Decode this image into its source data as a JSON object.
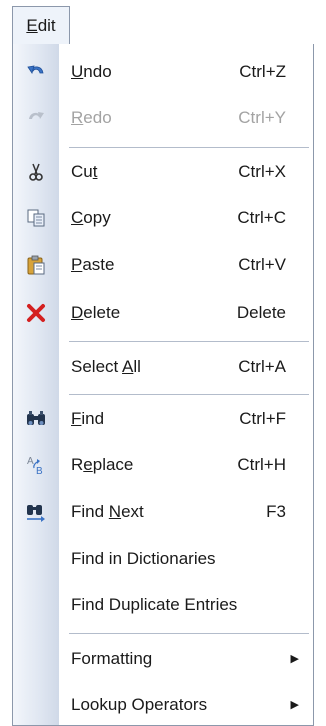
{
  "menubar": {
    "title": "Edit",
    "title_mnemonic": "E"
  },
  "menu": {
    "items": [
      {
        "label": "Undo",
        "mnemonic": "U",
        "shortcut": "Ctrl+Z",
        "icon": "undo-icon",
        "enabled": true
      },
      {
        "label": "Redo",
        "mnemonic": "R",
        "shortcut": "Ctrl+Y",
        "icon": "redo-icon",
        "enabled": false
      },
      {
        "label": "Cut",
        "mnemonic": "t",
        "shortcut": "Ctrl+X",
        "icon": "scissors-icon",
        "enabled": true
      },
      {
        "label": "Copy",
        "mnemonic": "C",
        "shortcut": "Ctrl+C",
        "icon": "copy-icon",
        "enabled": true
      },
      {
        "label": "Paste",
        "mnemonic": "P",
        "shortcut": "Ctrl+V",
        "icon": "clipboard-icon",
        "enabled": true
      },
      {
        "label": "Delete",
        "mnemonic": "D",
        "shortcut": "Delete",
        "icon": "delete-x-icon",
        "enabled": true
      },
      {
        "label": "Select All",
        "mnemonic": "A",
        "shortcut": "Ctrl+A",
        "icon": "",
        "enabled": true
      },
      {
        "label": "Find",
        "mnemonic": "F",
        "shortcut": "Ctrl+F",
        "icon": "binoculars-icon",
        "enabled": true
      },
      {
        "label": "Replace",
        "mnemonic": "e",
        "shortcut": "Ctrl+H",
        "icon": "replace-ab-icon",
        "enabled": true
      },
      {
        "label": "Find Next",
        "mnemonic": "N",
        "shortcut": "F3",
        "icon": "find-next-icon",
        "enabled": true
      },
      {
        "label": "Find in Dictionaries",
        "mnemonic": "",
        "shortcut": "",
        "icon": "",
        "enabled": true
      },
      {
        "label": "Find Duplicate Entries",
        "mnemonic": "",
        "shortcut": "",
        "icon": "",
        "enabled": true
      },
      {
        "label": "Formatting",
        "mnemonic": "",
        "shortcut": "",
        "icon": "",
        "enabled": true,
        "submenu": true
      },
      {
        "label": "Lookup Operators",
        "mnemonic": "",
        "shortcut": "",
        "icon": "",
        "enabled": true,
        "submenu": true
      }
    ],
    "submenu_arrow": "▶"
  },
  "colors": {
    "undo_blue": "#3a72c4",
    "delete_red": "#d42020",
    "disabled_text": "#a3a3a3",
    "gutter": "#dfe6f1"
  }
}
